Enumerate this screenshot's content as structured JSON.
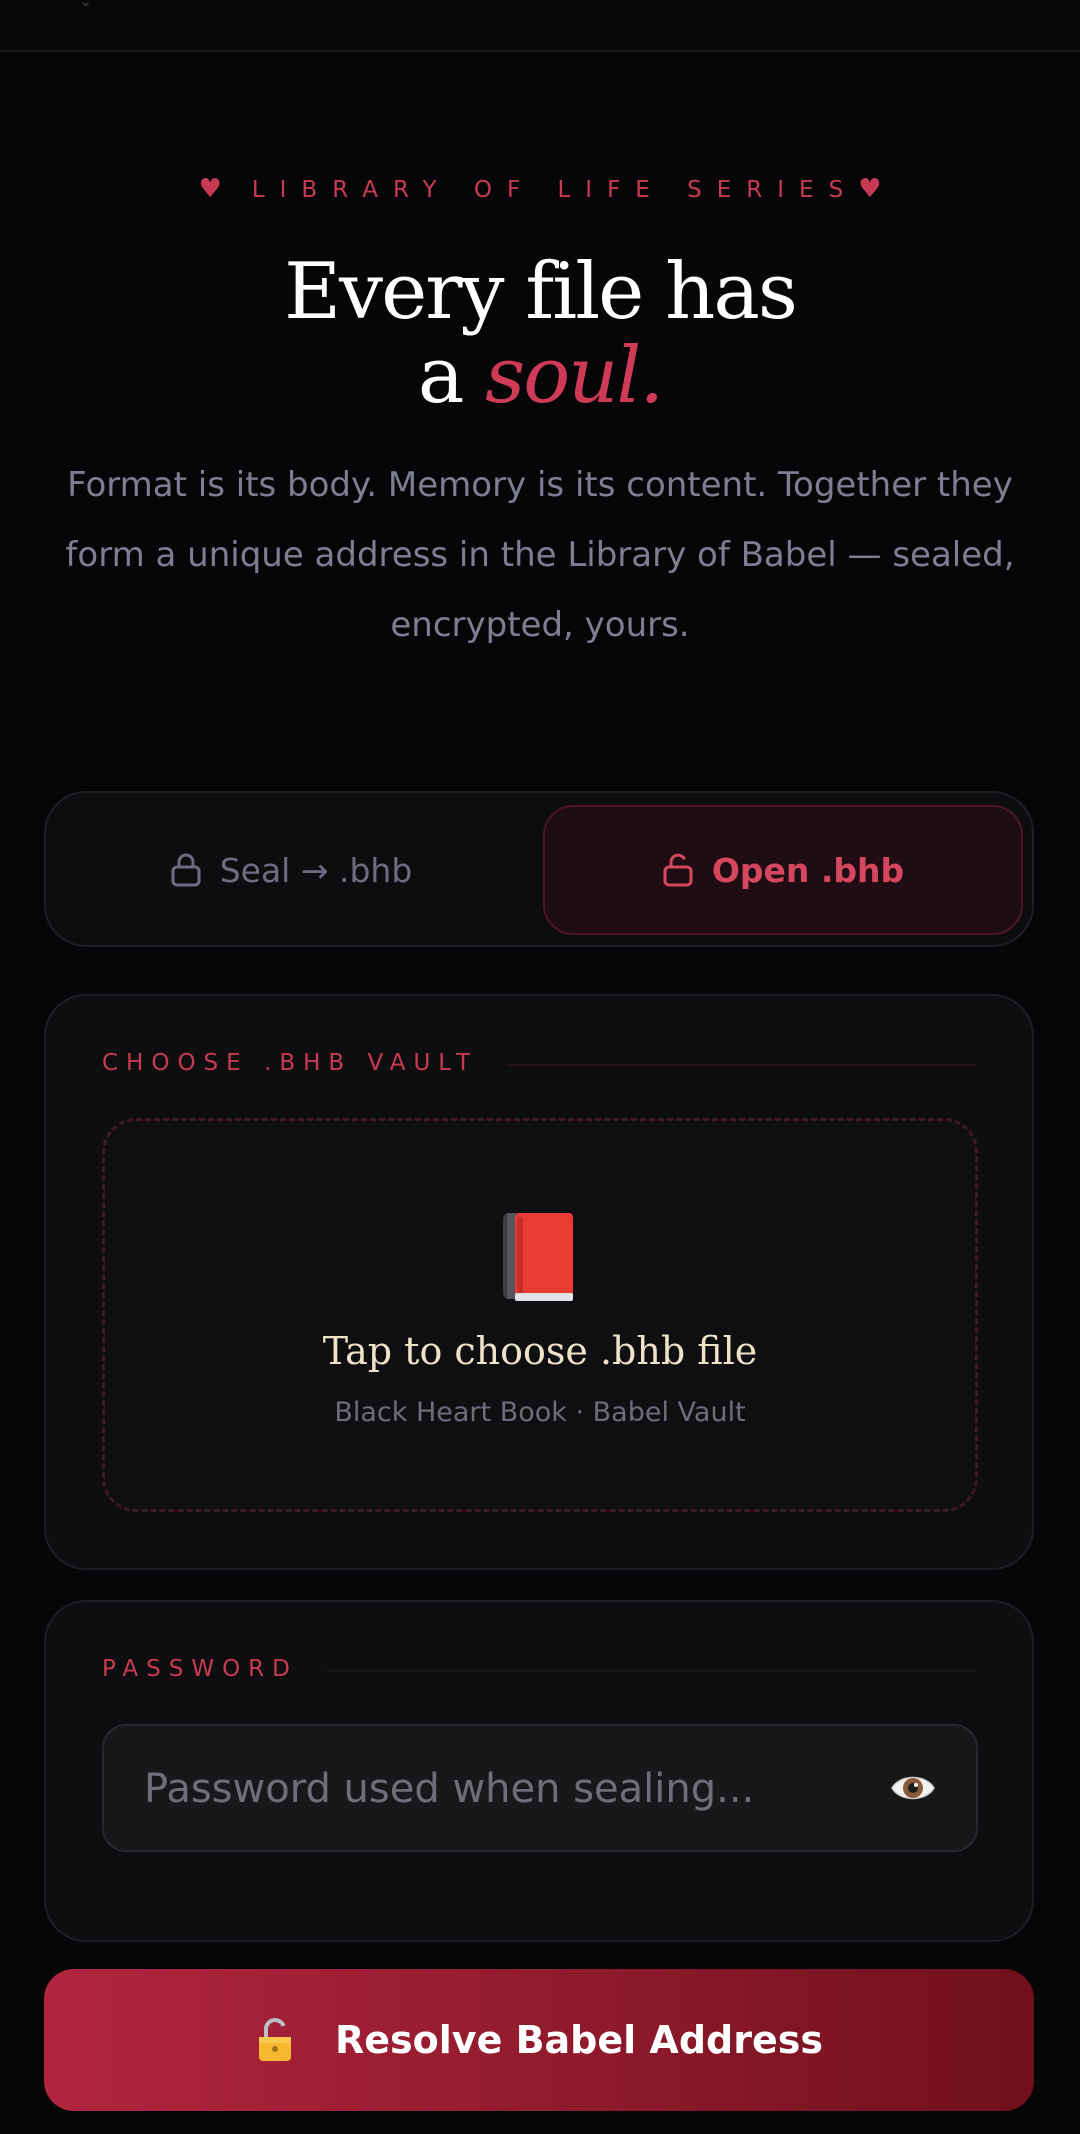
{
  "hero": {
    "eyebrow": "LIBRARY OF LIFE SERIES",
    "title_line1": "Every file has",
    "title_line2_prefix": "a",
    "title_accent": "soul.",
    "lede": "Format is its body. Memory is its content. Together they form a unique address in the Library of Babel — sealed, encrypted, yours."
  },
  "modes": {
    "seal_label": "Seal → .bhb",
    "open_label": "Open .bhb",
    "active": "open"
  },
  "vault": {
    "section_label": "CHOOSE .BHB VAULT",
    "drop_title": "Tap to choose .bhb file",
    "drop_subtitle": "Black Heart Book · Babel Vault"
  },
  "password": {
    "section_label": "PASSWORD",
    "placeholder": "Password used when sealing..."
  },
  "actions": {
    "resolve_label": "Resolve Babel Address"
  },
  "colors": {
    "accent": "#cf3a57",
    "background": "#060609"
  },
  "icons": {
    "eyebrow_ornament": "heart-icon",
    "seal": "lock-icon",
    "open": "unlock-icon",
    "vault": "book-icon",
    "reveal": "eye-icon",
    "resolve": "unlock-icon"
  }
}
